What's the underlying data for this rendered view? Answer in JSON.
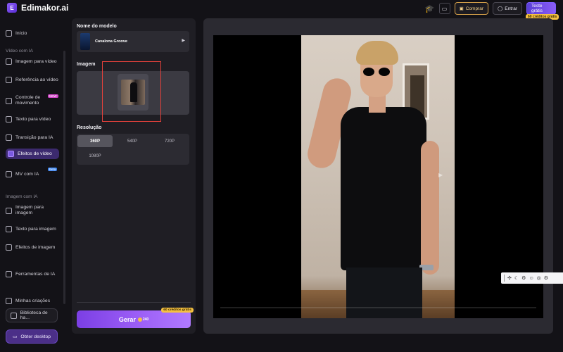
{
  "app": {
    "name": "Edimakor.ai",
    "logo_glyph": "E"
  },
  "header": {
    "buy_label": "Comprar",
    "login_label": "Entrar",
    "try_free_label": "Teste grátis",
    "free_credits_badge": "60 créditos grátis",
    "buy_icon": "cart-icon",
    "login_icon": "user-icon"
  },
  "sidebar": {
    "home": "Início",
    "section_video": "Vídeo com IA",
    "items_video": [
      {
        "label": "Imagem para vídeo",
        "icon": "image-video-icon"
      },
      {
        "label": "Referência ao vídeo",
        "icon": "reference-icon"
      },
      {
        "label": "Controle de movimento",
        "icon": "motion-icon",
        "tag": "NEW"
      },
      {
        "label": "Texto para vídeo",
        "icon": "text-video-icon"
      },
      {
        "label": "Transição para IA",
        "icon": "transition-icon"
      },
      {
        "label": "Efeitos de vídeo",
        "icon": "effects-icon",
        "active": true
      },
      {
        "label": "MV com IA",
        "icon": "mv-icon",
        "tag": "Beta"
      }
    ],
    "section_image": "Imagem com IA",
    "items_image": [
      {
        "label": "Imagem para imagem",
        "icon": "image-image-icon"
      },
      {
        "label": "Texto para imagem",
        "icon": "text-image-icon"
      },
      {
        "label": "Efeitos de imagem",
        "icon": "image-effects-icon"
      }
    ],
    "tools": "Ferramentas de IA",
    "my_creations": "Minhas criações",
    "library": "Biblioteca de ha...",
    "desktop": "Obter desktop"
  },
  "panel": {
    "model_label": "Nome do modelo",
    "model_name": "Cavalona Groove",
    "image_label": "Imagem",
    "resolution_label": "Resolução",
    "resolutions": [
      "360P",
      "540P",
      "720P",
      "1080P"
    ],
    "selected_resolution": "360P",
    "generate_label": "Gerar",
    "generate_cost": "240",
    "generate_badge": "60 créditos grátis"
  },
  "colors": {
    "accent": "#8b5cf6",
    "highlight": "#e5413b",
    "coin": "#f5c142"
  }
}
